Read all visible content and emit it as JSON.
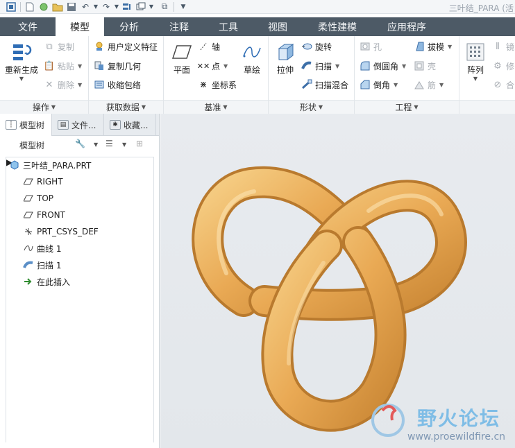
{
  "window": {
    "title": "三叶结_PARA (活"
  },
  "quick_access": {
    "icons": [
      "app-icon",
      "new-icon",
      "open-session-icon",
      "open-folder-icon",
      "save-icon",
      "undo-icon",
      "undo-dropdown-icon",
      "redo-icon",
      "redo-dropdown-icon",
      "regenerate-icon",
      "window-icon",
      "window-dropdown-icon",
      "close-window-icon",
      "customize-icon"
    ]
  },
  "tabs": [
    {
      "label": "文件",
      "active": false
    },
    {
      "label": "模型",
      "active": true
    },
    {
      "label": "分析",
      "active": false
    },
    {
      "label": "注释",
      "active": false
    },
    {
      "label": "工具",
      "active": false
    },
    {
      "label": "视图",
      "active": false
    },
    {
      "label": "柔性建模",
      "active": false
    },
    {
      "label": "应用程序",
      "active": false
    }
  ],
  "ribbon": {
    "operations": {
      "label": "操作",
      "regenerate": "重新生成",
      "copy": "复制",
      "paste": "粘贴",
      "delete": "删除"
    },
    "get_data": {
      "label": "获取数据",
      "udf": "用户定义特征",
      "copy_geom": "复制几何",
      "shrinkwrap": "收缩包络"
    },
    "datum": {
      "label": "基准",
      "plane": "平面",
      "axis": "轴",
      "point": "点",
      "csys": "坐标系",
      "sketch": "草绘"
    },
    "shapes": {
      "label": "形状",
      "extrude": "拉伸",
      "revolve": "旋转",
      "sweep": "扫描",
      "swept_blend": "扫描混合"
    },
    "engineering": {
      "label": "工程",
      "hole": "孔",
      "round": "倒圆角",
      "chamfer": "倒角",
      "draft": "拔模",
      "shell": "壳",
      "rib": "筋"
    },
    "editing": {
      "pattern": "阵列",
      "mirror": "镜",
      "modify": "修",
      "merge": "合"
    }
  },
  "panel": {
    "tabs": [
      {
        "label": "模型树",
        "active": true
      },
      {
        "label": "文件...",
        "active": false
      },
      {
        "label": "收藏...",
        "active": false
      }
    ],
    "toolbar_label": "模型树",
    "tree": [
      {
        "label": "三叶结_PARA.PRT",
        "icon": "part-icon",
        "indent": 0,
        "expandable": false
      },
      {
        "label": "RIGHT",
        "icon": "datum-plane-icon",
        "indent": 1,
        "expandable": false
      },
      {
        "label": "TOP",
        "icon": "datum-plane-icon",
        "indent": 1,
        "expandable": false
      },
      {
        "label": "FRONT",
        "icon": "datum-plane-icon",
        "indent": 1,
        "expandable": false
      },
      {
        "label": "PRT_CSYS_DEF",
        "icon": "csys-icon",
        "indent": 1,
        "expandable": false
      },
      {
        "label": "曲线 1",
        "icon": "curve-icon",
        "indent": 1,
        "expandable": false
      },
      {
        "label": "扫描 1",
        "icon": "sweep-icon",
        "indent": 1,
        "expandable": true
      },
      {
        "label": "在此插入",
        "icon": "insert-arrow-icon",
        "indent": 1,
        "expandable": false
      }
    ]
  },
  "viewport": {
    "model": "trefoil-knot",
    "model_color": "#f0b860"
  },
  "watermark": {
    "title": "野火论坛",
    "url": "www.proewildfire.cn"
  }
}
